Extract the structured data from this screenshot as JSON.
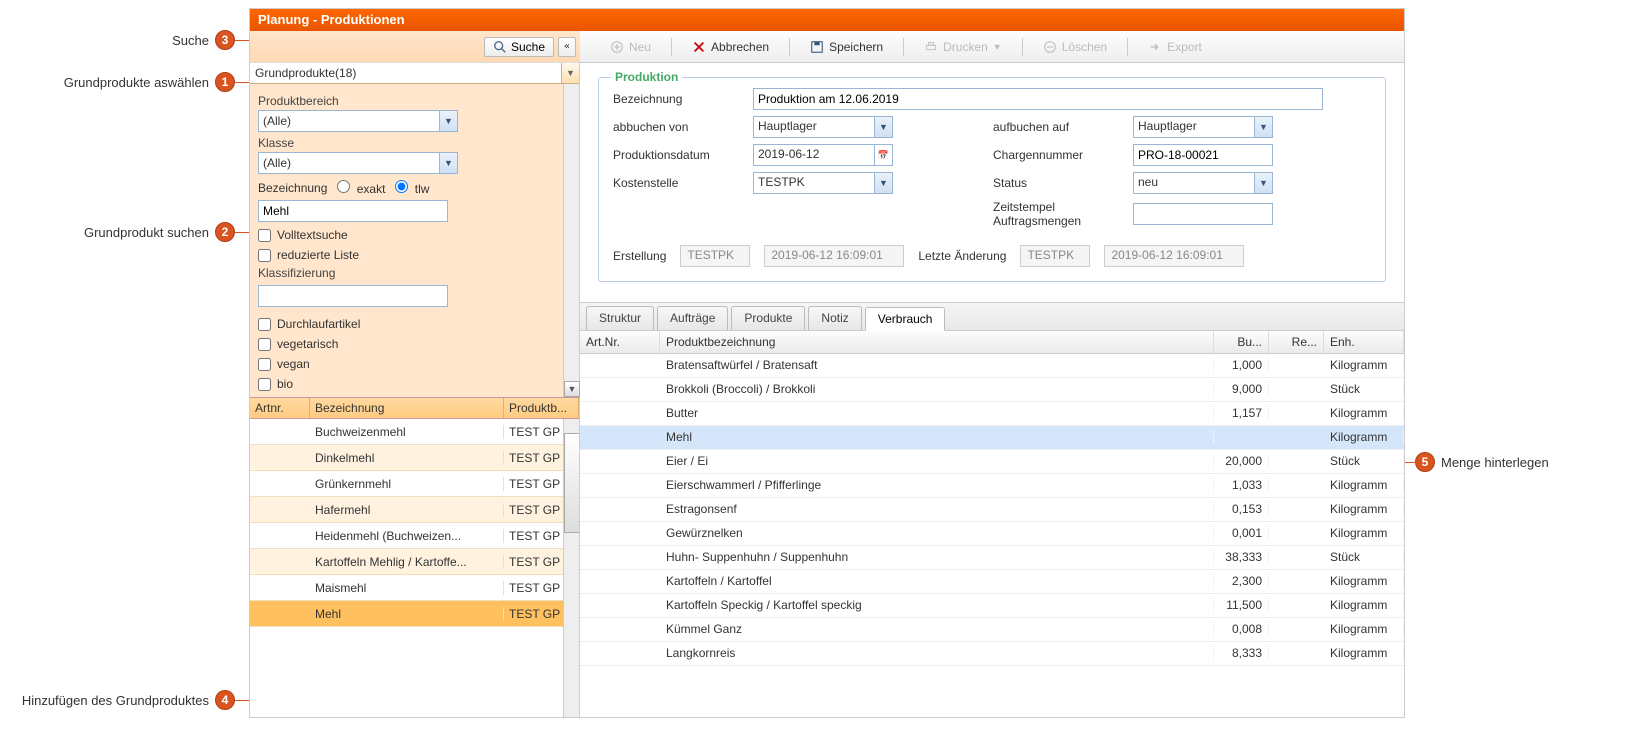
{
  "title": "Planung - Produktionen",
  "search_button": "Suche",
  "collapse_glyph": "«",
  "grundprodukte_label": "Grundprodukte(18)",
  "filter": {
    "produktbereich_label": "Produktbereich",
    "produktbereich_value": "(Alle)",
    "klasse_label": "Klasse",
    "klasse_value": "(Alle)",
    "bezeichnung_label": "Bezeichnung",
    "exakt_label": "exakt",
    "tlw_label": "tlw",
    "search_value": "Mehl",
    "volltext_label": "Volltextsuche",
    "reduzierte_label": "reduzierte Liste",
    "klassifizierung_label": "Klassifizierung",
    "durchlauf_label": "Durchlaufartikel",
    "vegetarisch_label": "vegetarisch",
    "vegan_label": "vegan",
    "bio_label": "bio"
  },
  "leftgrid": {
    "headers": {
      "artnr": "Artnr.",
      "bezeichnung": "Bezeichnung",
      "produktb": "Produktb..."
    },
    "rows": [
      {
        "art": "",
        "name": "Buchweizenmehl",
        "pb": "TEST GP"
      },
      {
        "art": "",
        "name": "Dinkelmehl",
        "pb": "TEST GP"
      },
      {
        "art": "",
        "name": "Grünkernmehl",
        "pb": "TEST GP"
      },
      {
        "art": "",
        "name": "Hafermehl",
        "pb": "TEST GP"
      },
      {
        "art": "",
        "name": "Heidenmehl (Buchweizen...",
        "pb": "TEST GP"
      },
      {
        "art": "",
        "name": "Kartoffeln Mehlig / Kartoffe...",
        "pb": "TEST GP"
      },
      {
        "art": "",
        "name": "Maismehl",
        "pb": "TEST GP"
      },
      {
        "art": "",
        "name": "Mehl",
        "pb": "TEST GP"
      }
    ]
  },
  "toolbar": {
    "neu": "Neu",
    "abbrechen": "Abbrechen",
    "speichern": "Speichern",
    "drucken": "Drucken",
    "loeschen": "Löschen",
    "export": "Export"
  },
  "form": {
    "legend": "Produktion",
    "bezeichnung_label": "Bezeichnung",
    "bezeichnung_value": "Produktion am 12.06.2019",
    "abbuchen_label": "abbuchen von",
    "abbuchen_value": "Hauptlager",
    "aufbuchen_label": "aufbuchen auf",
    "aufbuchen_value": "Hauptlager",
    "datum_label": "Produktionsdatum",
    "datum_value": "2019-06-12",
    "chargen_label": "Chargennummer",
    "chargen_value": "PRO-18-00021",
    "kosten_label": "Kostenstelle",
    "kosten_value": "TESTPK",
    "status_label": "Status",
    "status_value": "neu",
    "zeitstempel_label": "Zeitstempel Auftragsmengen",
    "erstellung_label": "Erstellung",
    "erstellung_user": "TESTPK",
    "erstellung_time": "2019-06-12 16:09:01",
    "aenderung_label": "Letzte Änderung",
    "aenderung_user": "TESTPK",
    "aenderung_time": "2019-06-12 16:09:01"
  },
  "tabs": [
    {
      "label": "Struktur"
    },
    {
      "label": "Aufträge"
    },
    {
      "label": "Produkte"
    },
    {
      "label": "Notiz"
    },
    {
      "label": "Verbrauch"
    }
  ],
  "datagrid": {
    "headers": {
      "artnr": "Art.Nr.",
      "name": "Produktbezeichnung",
      "bu": "Bu...",
      "re": "Re...",
      "enh": "Enh."
    },
    "rows": [
      {
        "name": "Bratensaftwürfel / Bratensaft",
        "bu": "1,000",
        "enh": "Kilogramm"
      },
      {
        "name": "Brokkoli (Broccoli) / Brokkoli",
        "bu": "9,000",
        "enh": "Stück"
      },
      {
        "name": "Butter",
        "bu": "1,157",
        "enh": "Kilogramm"
      },
      {
        "name": "Mehl",
        "bu": "",
        "enh": "Kilogramm"
      },
      {
        "name": "Eier / Ei",
        "bu": "20,000",
        "enh": "Stück"
      },
      {
        "name": "Eierschwammerl / Pfifferlinge",
        "bu": "1,033",
        "enh": "Kilogramm"
      },
      {
        "name": "Estragonsenf",
        "bu": "0,153",
        "enh": "Kilogramm"
      },
      {
        "name": "Gewürznelken",
        "bu": "0,001",
        "enh": "Kilogramm"
      },
      {
        "name": "Huhn- Suppenhuhn / Suppenhuhn",
        "bu": "38,333",
        "enh": "Stück"
      },
      {
        "name": "Kartoffeln / Kartoffel",
        "bu": "2,300",
        "enh": "Kilogramm"
      },
      {
        "name": "Kartoffeln Speckig / Kartoffel speckig",
        "bu": "11,500",
        "enh": "Kilogramm"
      },
      {
        "name": "Kümmel Ganz",
        "bu": "0,008",
        "enh": "Kilogramm"
      },
      {
        "name": "Langkornreis",
        "bu": "8,333",
        "enh": "Kilogramm"
      }
    ]
  },
  "callouts": {
    "c1": "Grundprodukte aswählen",
    "c2": "Grundprodukt suchen",
    "c3": "Suche",
    "c4": "Hinzufügen des Grundproduktes",
    "c5": "Menge hinterlegen"
  }
}
